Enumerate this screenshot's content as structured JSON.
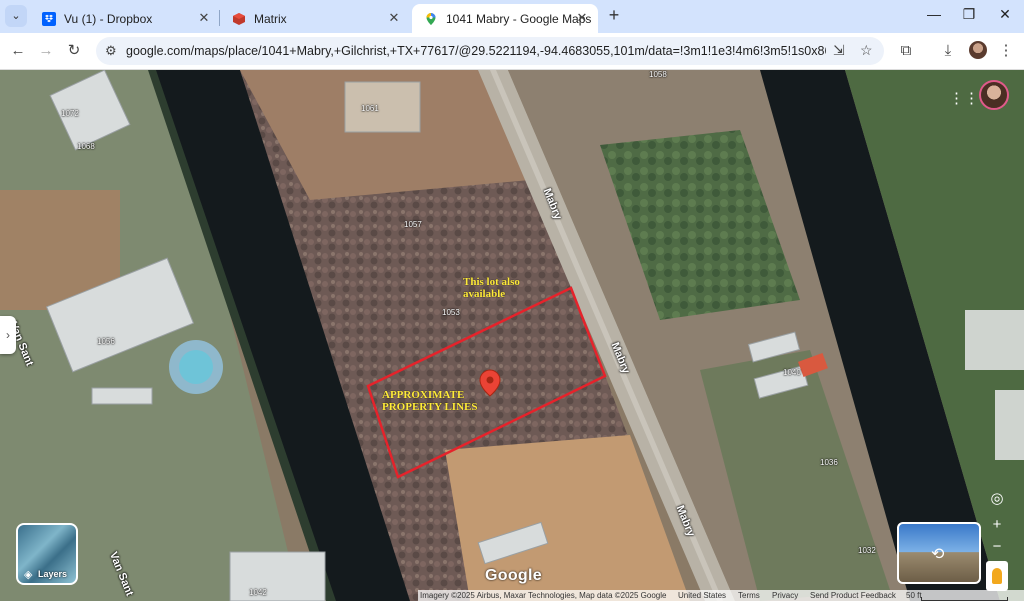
{
  "browser": {
    "tabs": [
      {
        "title": "Vu (1) - Dropbox",
        "icon": "dropbox-icon"
      },
      {
        "title": "Matrix",
        "icon": "matrix-icon"
      },
      {
        "title": "1041 Mabry - Google Maps",
        "icon": "google-maps-icon",
        "active": true
      }
    ],
    "url": "google.com/maps/place/1041+Mabry,+Gilchrist,+TX+77617/@29.5221194,-94.4683055,101m/data=!3m1!1e3!4m6!3m5!1s0x863f034e6d29..."
  },
  "map": {
    "parcel_labels": [
      "1058",
      "1061",
      "1072",
      "1068",
      "1057",
      "1053",
      "1056",
      "1040",
      "1036",
      "1032",
      "1042"
    ],
    "streets": [
      "Mabry",
      "Mabry",
      "Mabry",
      "Van Sant",
      "Van Sant"
    ],
    "annotations": {
      "lot_available": "This lot also available",
      "property_lines": "APPROXIMATE PROPERTY LINES"
    },
    "layers_label": "Layers",
    "logo": "Google",
    "attribution": {
      "imagery": "Imagery ©2025 Airbus, Maxar Technologies, Map data ©2025 Google",
      "links": [
        "United States",
        "Terms",
        "Privacy",
        "Send Product Feedback"
      ],
      "scale": "50 ft"
    },
    "controls": {
      "zoom_in": "+",
      "zoom_out": "−"
    },
    "colors": {
      "property_outline": "#e5232b",
      "annotation_text": "#ffeb3b",
      "map_pin": "#ea4335"
    }
  }
}
